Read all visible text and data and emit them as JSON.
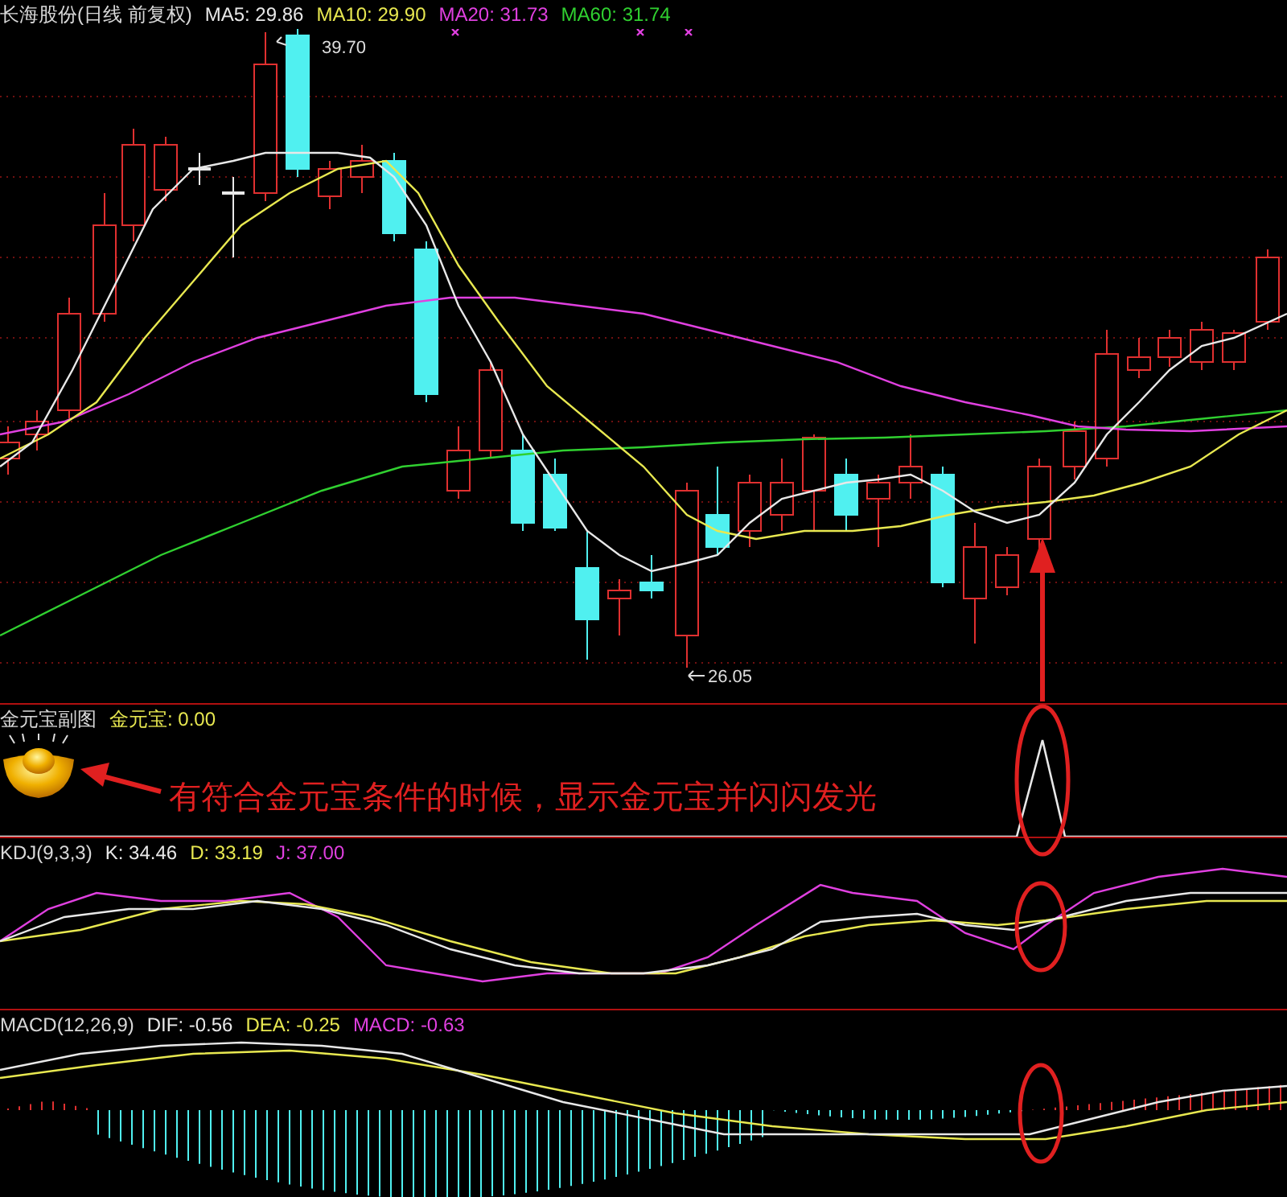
{
  "window": {
    "title": "长海股份(日线 前复权)"
  },
  "main_panel": {
    "indicators": [
      {
        "label": "MA5: 29.86",
        "color": "#e8e8e8"
      },
      {
        "label": "MA10: 29.90",
        "color": "#e8e850"
      },
      {
        "label": "MA20: 31.73",
        "color": "#e040e0"
      },
      {
        "label": "MA60: 31.74",
        "color": "#30d030"
      }
    ],
    "high_label": "39.70",
    "low_label": "26.05"
  },
  "gold_panel": {
    "title": "金元宝副图",
    "indicators": [
      {
        "label": "金元宝: 0.00",
        "color": "#e8e850"
      }
    ],
    "annotation": "有符合金元宝条件的时候，显示金元宝并闪闪发光"
  },
  "kdj_panel": {
    "title": "KDJ(9,3,3)",
    "indicators": [
      {
        "label": "K: 34.46",
        "color": "#e8e8e8"
      },
      {
        "label": "D: 33.19",
        "color": "#e8e850"
      },
      {
        "label": "J: 37.00",
        "color": "#e040e0"
      }
    ]
  },
  "macd_panel": {
    "title": "MACD(12,26,9)",
    "indicators": [
      {
        "label": "DIF: -0.56",
        "color": "#e8e8e8"
      },
      {
        "label": "DEA: -0.25",
        "color": "#e8e850"
      },
      {
        "label": "MACD: -0.63",
        "color": "#e040e0"
      }
    ]
  }
}
